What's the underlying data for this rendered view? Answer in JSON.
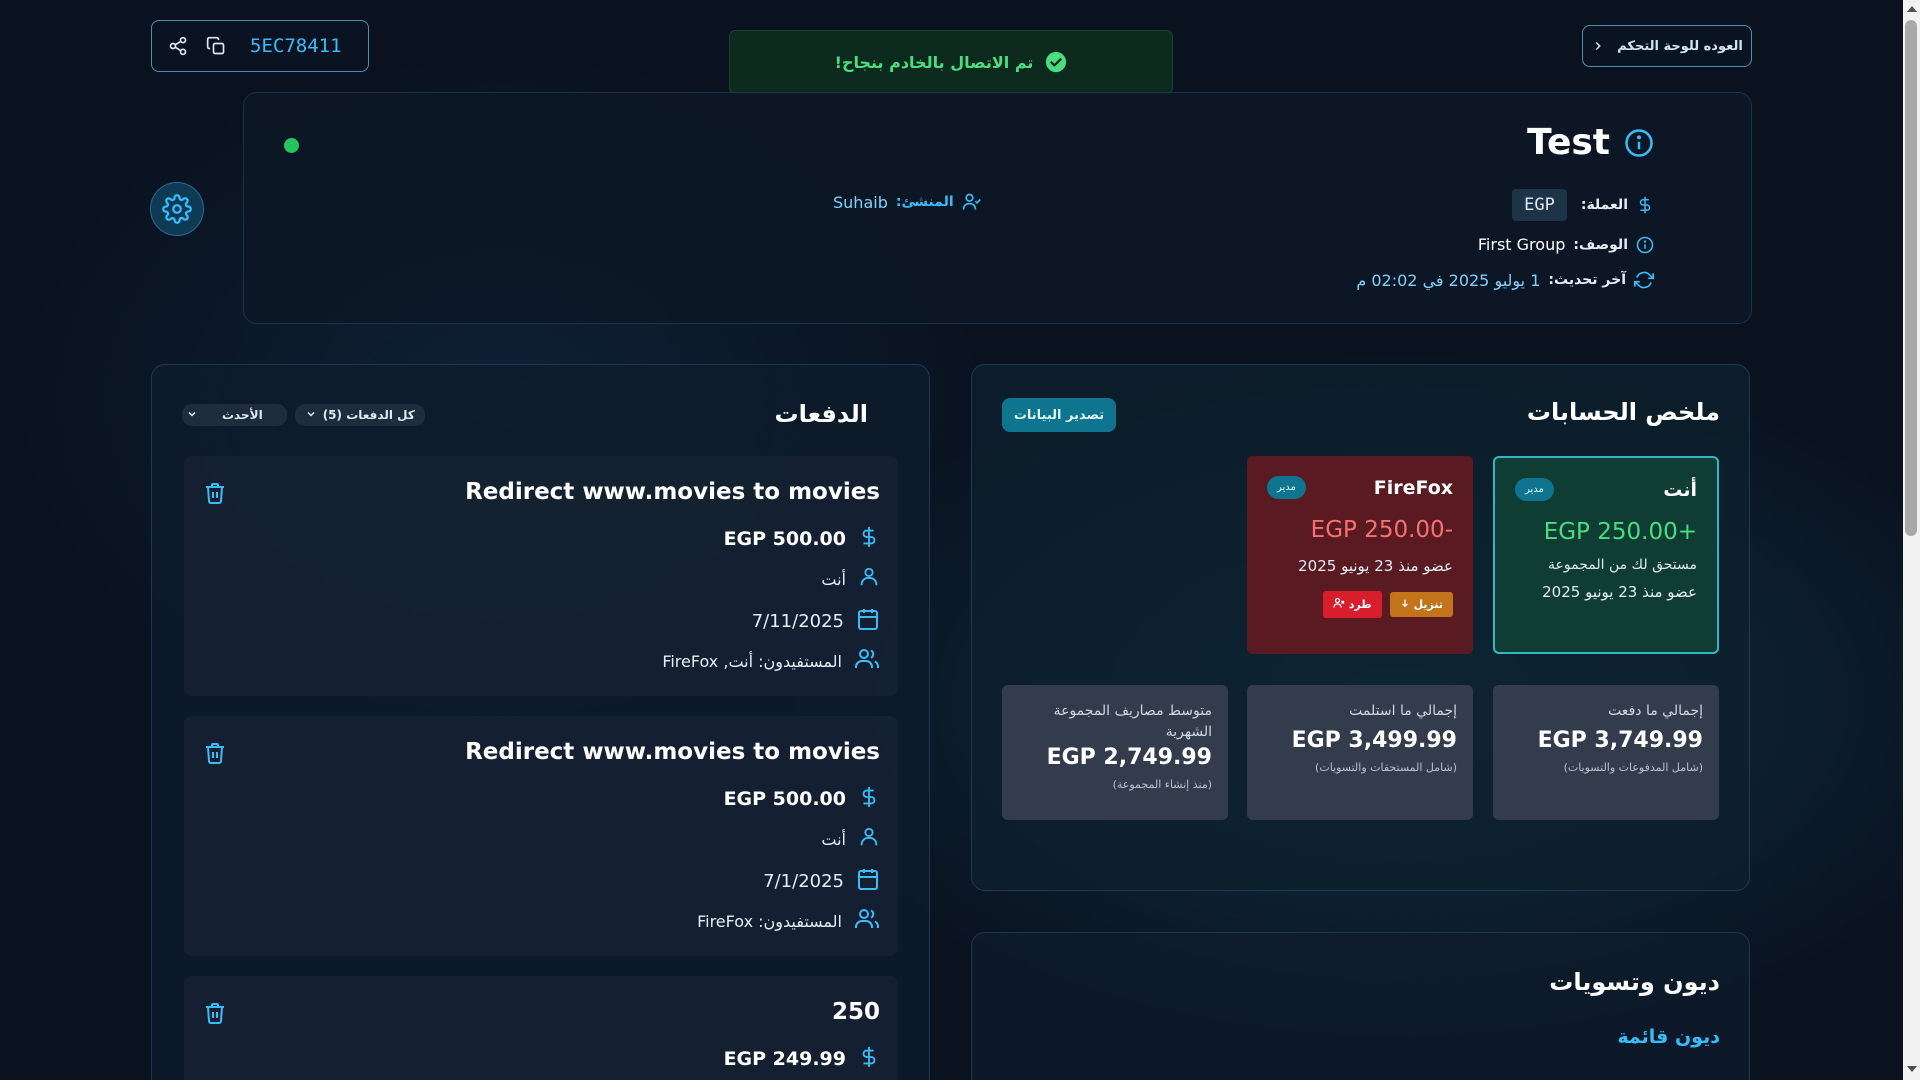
{
  "share": {
    "code": "5EC78411"
  },
  "toast": {
    "message": "تم الاتصال بالخادم بنجاح!"
  },
  "nav": {
    "back_label": "العوده للوحة التحكم"
  },
  "group": {
    "name": "Test",
    "creator_label": "المنشئ:",
    "creator": "Suhaib",
    "currency_label": "العملة:",
    "currency": "EGP",
    "description_label": "الوصف:",
    "description": "First Group",
    "updated_label": "آخر تحديث:",
    "updated": "1 يوليو 2025 في 02:02 م"
  },
  "payments": {
    "title": "الدفعات",
    "filter_all": "كل الدفعات (5)",
    "filter_sort": "الأحدث",
    "items": [
      {
        "title": "Redirect www.movies to movies",
        "amount": "EGP 500.00",
        "payer": "أنت",
        "date": "7/11/2025",
        "beneficiaries": "المستفيدون: أنت, FireFox"
      },
      {
        "title": "Redirect www.movies to movies",
        "amount": "EGP 500.00",
        "payer": "أنت",
        "date": "7/1/2025",
        "beneficiaries": "المستفيدون: FireFox"
      },
      {
        "title": "250",
        "amount": "EGP 249.99"
      }
    ]
  },
  "summary": {
    "title": "ملخص الحسابات",
    "export_label": "تصدير البيانات",
    "members": [
      {
        "name": "أنت",
        "role": "مدير",
        "balance": "+EGP 250.00",
        "note": "مستحق لك من المجموعة",
        "joined": "عضو منذ 23 يونيو 2025"
      },
      {
        "name": "FireFox",
        "role": "مدير",
        "balance": "-EGP 250.00",
        "joined": "عضو منذ 23 يونيو 2025",
        "demote_label": "تنزيل",
        "kick_label": "طرد"
      }
    ],
    "stats": [
      {
        "label": "إجمالي ما دفعت",
        "value": "EGP 3,749.99",
        "note": "(شامل المدفوعات والتسويات)"
      },
      {
        "label": "إجمالي ما استلمت",
        "value": "EGP 3,499.99",
        "note": "(شامل المستحقات والتسويات)"
      },
      {
        "label": "متوسط مصاريف المجموعة الشهرية",
        "value": "EGP 2,749.99",
        "note": "(منذ إنشاء المجموعة)"
      }
    ],
    "colors": {
      "positive": "#4ade80",
      "negative": "#f87171"
    }
  },
  "debts": {
    "title": "ديون وتسويات",
    "subtitle": "ديون قائمة"
  }
}
